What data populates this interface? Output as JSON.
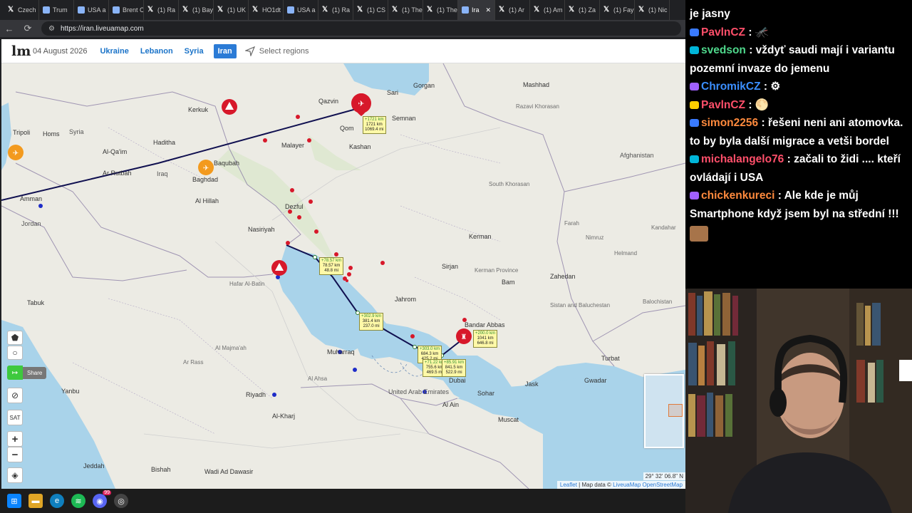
{
  "browser": {
    "tabs": [
      {
        "label": "Czech",
        "icon": "x-icon"
      },
      {
        "label": "Trum",
        "icon": "site-icon"
      },
      {
        "label": "USA a",
        "icon": "site-icon"
      },
      {
        "label": "Brent C",
        "icon": "site-icon"
      },
      {
        "label": "(1) Ra",
        "icon": "x-icon"
      },
      {
        "label": "(1) Bay",
        "icon": "x-icon"
      },
      {
        "label": "(1) UK",
        "icon": "x-icon"
      },
      {
        "label": "HO1dt",
        "icon": "x-icon"
      },
      {
        "label": "USA a",
        "icon": "site-icon"
      },
      {
        "label": "(1) Ra",
        "icon": "x-icon"
      },
      {
        "label": "(1) CS",
        "icon": "x-icon"
      },
      {
        "label": "(1) The",
        "icon": "x-icon"
      },
      {
        "label": "(1) The",
        "icon": "x-icon"
      },
      {
        "label": "Ira",
        "icon": "site-icon",
        "active": true
      },
      {
        "label": "(1) Ar",
        "icon": "x-icon"
      },
      {
        "label": "(1) Am",
        "icon": "x-icon"
      },
      {
        "label": "(1) Za",
        "icon": "x-icon"
      },
      {
        "label": "(1) Fay",
        "icon": "x-icon"
      },
      {
        "label": "(1) Nic",
        "icon": "x-icon"
      }
    ],
    "url": "https://iran.liveuamap.com"
  },
  "site": {
    "logo": "lm",
    "date": "04 August 2026",
    "regions": [
      "Ukraine",
      "Lebanon",
      "Syria",
      "Iran"
    ],
    "active_region": "Iran",
    "select_regions": "Select regions"
  },
  "map": {
    "labels": {
      "caspian": [
        "Gorgan",
        "Sari",
        "Qazvin",
        "Semnan",
        "Mashhad"
      ],
      "cities": [
        "Qom",
        "Kashan",
        "Malayer",
        "Baghdad",
        "Al Hillah",
        "Homs",
        "Amman",
        "Nasiriyah",
        "Kerman",
        "Bandar Abbas",
        "Jahrom",
        "Bam",
        "Zahedan",
        "Turbat",
        "Gwadar",
        "Muscat",
        "Riyadh",
        "Al Ain",
        "Dubai"
      ],
      "regions": [
        "Syria",
        "Iraq",
        "Jordan",
        "Tabuk",
        "Hafar Al-Batin",
        "Al Majma'ah",
        "Ar Rass",
        "Al Ahsa",
        "Afghanistan",
        "United Arab Emirates",
        "Razavi Khorasan",
        "South Khorasan",
        "Kerman Province",
        "Sistan and Baluchestan",
        "Farah",
        "Nimruz",
        "Helmand",
        "Kandahar",
        "Balochistan",
        "Al-Qa'im",
        "Ar Rutbah",
        "Baqubah",
        "Tripoli",
        "Kerkuk",
        "Dezful",
        "Haditha",
        "Sirjan",
        "Jask",
        "Muharraq",
        "Sohar",
        "Jeddah",
        "Wadi Ad Dawasir",
        "Bishah",
        "Al-Kharj",
        "Yanbu"
      ]
    },
    "measurements": [
      {
        "segment": "+1721 km",
        "distance_km": "1721 km",
        "distance_mi": "1069.4 mi"
      },
      {
        "segment": "+78.57 km",
        "distance_km": "78.57 km",
        "distance_mi": "48.8 mi"
      },
      {
        "segment": "+302.9 km",
        "distance_km": "381.4 km",
        "distance_mi": "237.0 mi"
      },
      {
        "segment": "+303.0 km",
        "distance_km": "684.3 km",
        "distance_mi": "425.2 mi"
      },
      {
        "segment": "+71.22 km",
        "distance_km": "755.6 km",
        "distance_mi": "469.5 mi"
      },
      {
        "segment": "+85.91 km",
        "distance_km": "841.5 km",
        "distance_mi": "522.9 mi"
      },
      {
        "segment": "+200.0 km",
        "distance_km": "1041 km",
        "distance_mi": "646.8 mi"
      }
    ],
    "controls": {
      "share": "Share",
      "sat": "SAT",
      "zoom_in": "+",
      "zoom_out": "−"
    },
    "coords": "29° 32' 06.8\" N",
    "attribution": {
      "leaflet": "Leaflet",
      "sep": " | Map data © ",
      "provider": "LiveuaMap OpenStreetMap"
    }
  },
  "taskbar": {
    "icons": [
      "windows-icon",
      "folder-icon",
      "edge-icon",
      "spotify-icon",
      "discord-icon",
      "obs-icon"
    ],
    "discord_badge": "99"
  },
  "chat": {
    "top_line": "je jasny",
    "messages": [
      {
        "user": "PavlnCZ",
        "color": "#ff4f6a",
        "text": "",
        "emote": "🦟"
      },
      {
        "user": "svedson",
        "color": "#4fd88c",
        "text": "vždyť saudi mají i variantu pozemní invaze do jemenu"
      },
      {
        "user": "ChromikCZ",
        "color": "#3b8fff",
        "text": "",
        "emote": "⚙"
      },
      {
        "user": "PavlnCZ",
        "color": "#ff4f6a",
        "text": "",
        "emote": "🌕"
      },
      {
        "user": "simon2256",
        "color": "#ff8a3d",
        "text": "řešeni neni ani atomovka. to by byla další migrace a vetši bordel"
      },
      {
        "user": "michalangelo76",
        "color": "#ff4f6a",
        "text": "začali to židi .... kteří ovládají i USA"
      },
      {
        "user": "chickenkureci",
        "color": "#ff8a3d",
        "text": "Ale kde je můj Smartphone když jsem byl na střední !!!"
      }
    ]
  }
}
